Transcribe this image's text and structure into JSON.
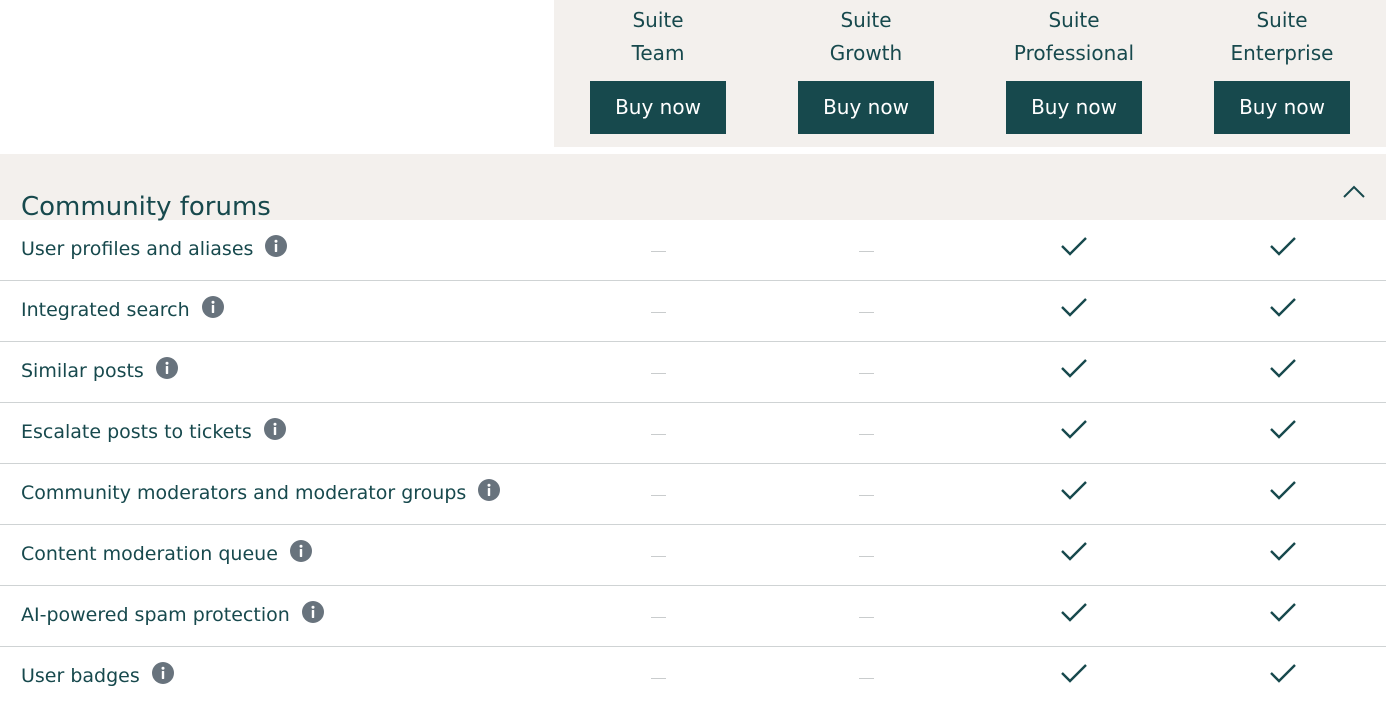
{
  "plans": [
    {
      "line1": "Suite",
      "line2": "Team",
      "button": "Buy now"
    },
    {
      "line1": "Suite",
      "line2": "Growth",
      "button": "Buy now"
    },
    {
      "line1": "Suite",
      "line2": "Professional",
      "button": "Buy now"
    },
    {
      "line1": "Suite",
      "line2": "Enterprise",
      "button": "Buy now"
    }
  ],
  "section": {
    "title": "Community forums",
    "toggle_icon": "chevron-up-icon",
    "features": [
      {
        "label": "User profiles and aliases",
        "availability": [
          false,
          false,
          true,
          true
        ]
      },
      {
        "label": "Integrated search",
        "availability": [
          false,
          false,
          true,
          true
        ]
      },
      {
        "label": "Similar posts",
        "availability": [
          false,
          false,
          true,
          true
        ]
      },
      {
        "label": "Escalate posts to tickets",
        "availability": [
          false,
          false,
          true,
          true
        ]
      },
      {
        "label": "Community moderators and moderator groups",
        "availability": [
          false,
          false,
          true,
          true
        ]
      },
      {
        "label": "Content moderation queue",
        "availability": [
          false,
          false,
          true,
          true
        ]
      },
      {
        "label": "AI-powered spam protection",
        "availability": [
          false,
          false,
          true,
          true
        ]
      },
      {
        "label": "User badges",
        "availability": [
          false,
          false,
          true,
          true
        ]
      }
    ]
  },
  "colors": {
    "brand": "#17494d",
    "band": "#f3f0ed",
    "info_icon": "#68737d",
    "divider": "#cfd3d4",
    "dash": "#c9cccd"
  }
}
